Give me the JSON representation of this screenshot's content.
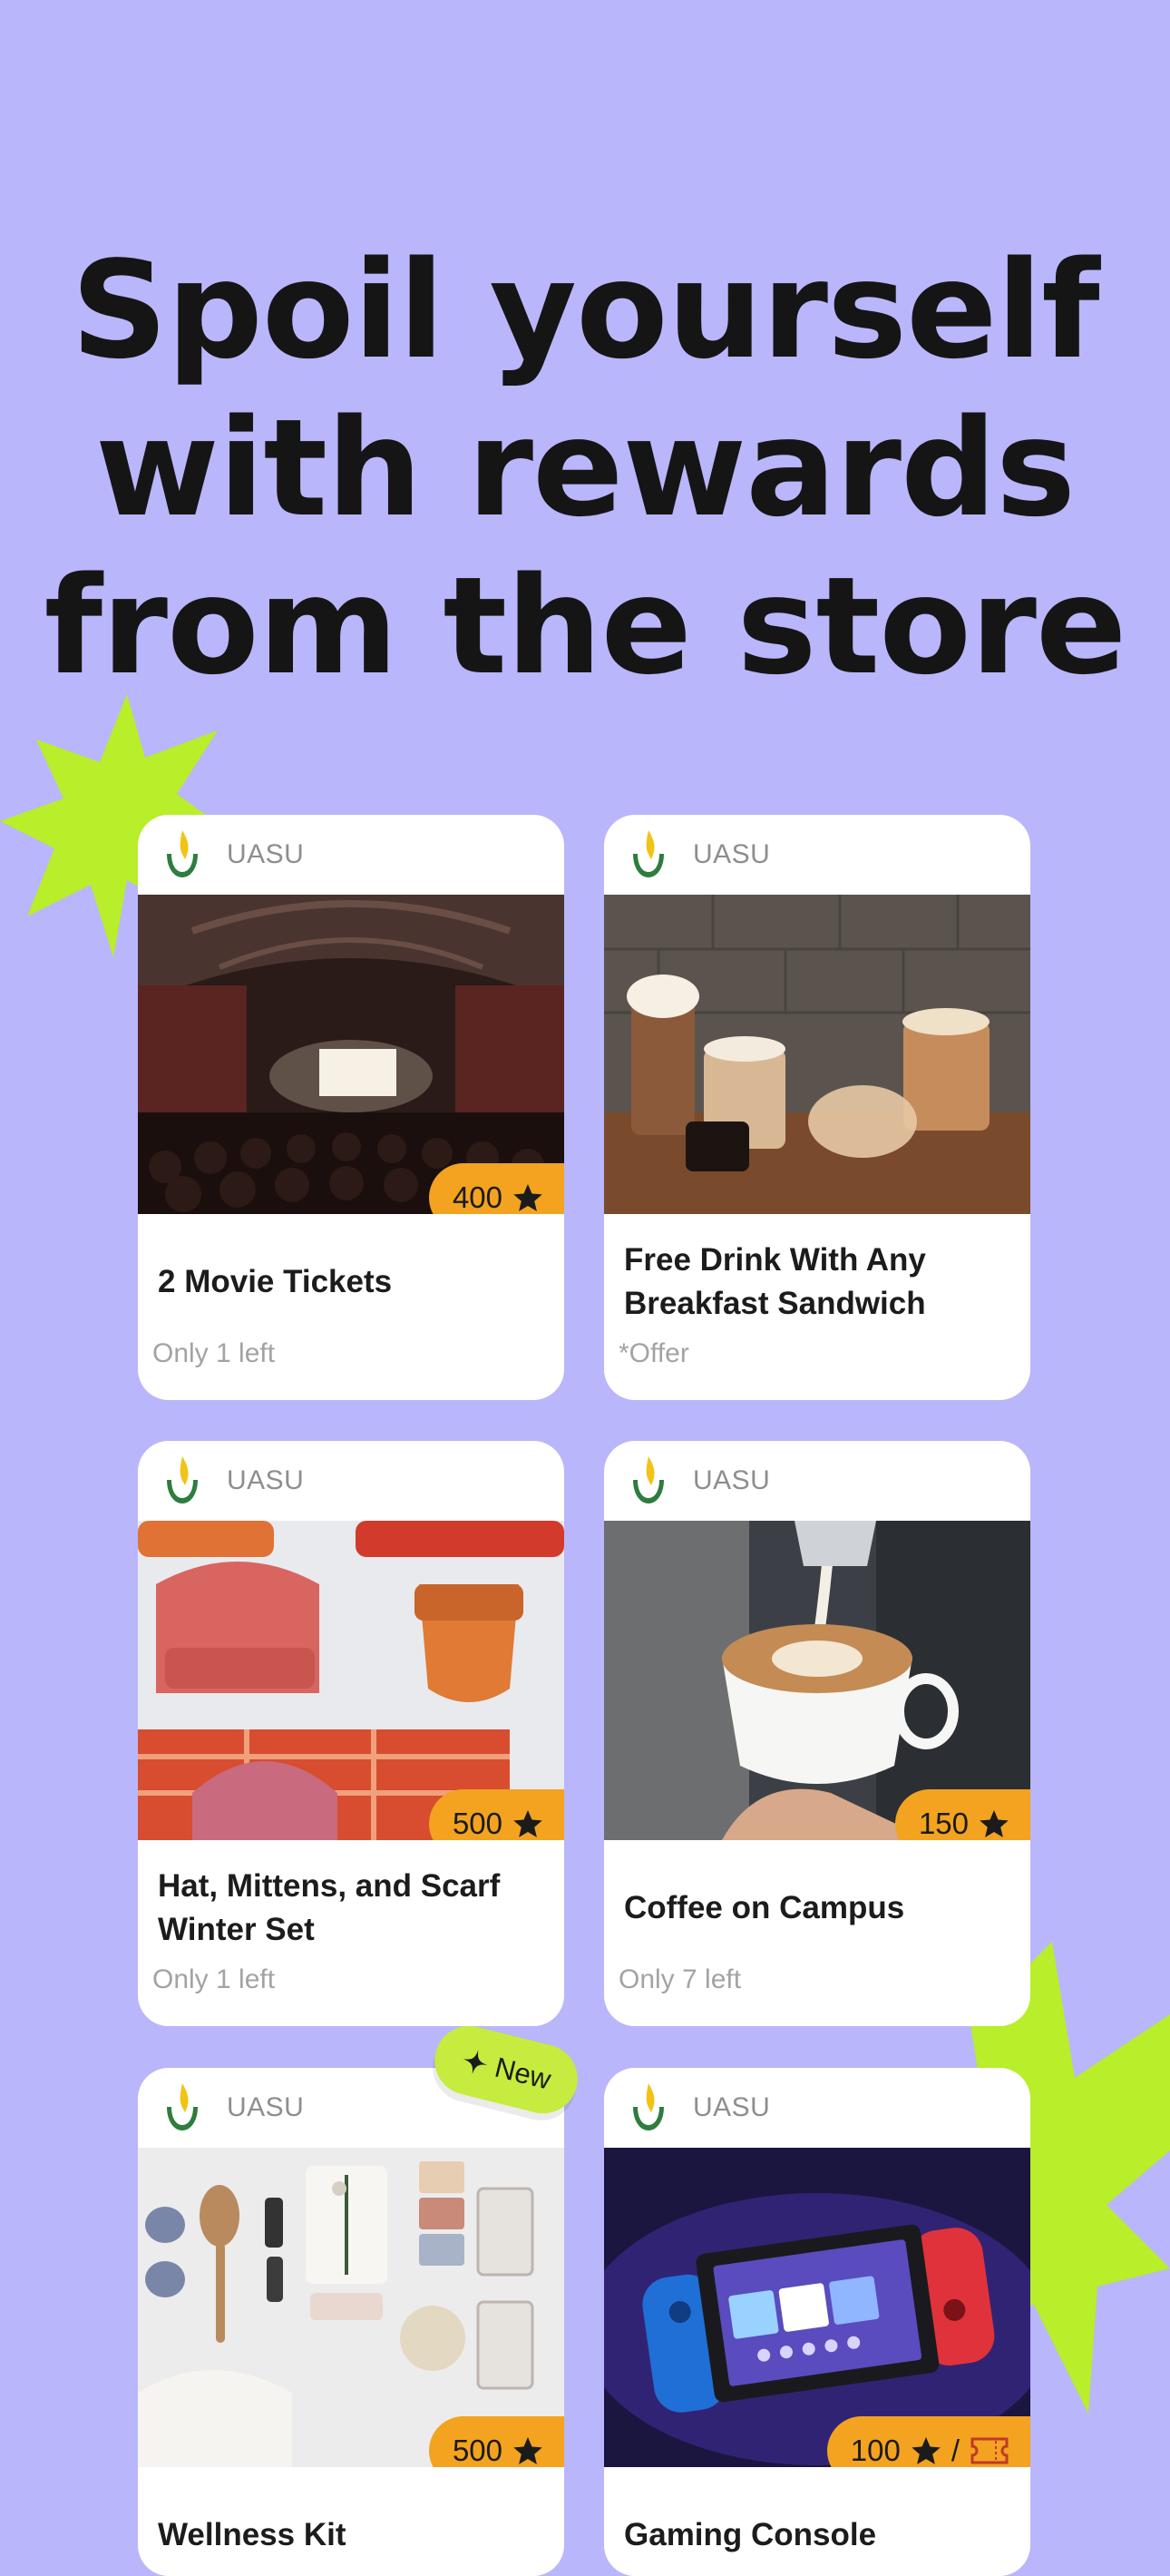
{
  "headline": {
    "line1": "Spoil yourself",
    "line2": "with rewards",
    "line3": "from the store"
  },
  "colors": {
    "background": "#b9b6fb",
    "accent_lime": "#b8ee2a",
    "badge_orange": "#f3a31f"
  },
  "cards": [
    {
      "brand": "UASU",
      "title": "2 Movie Tickets",
      "price": "400",
      "footer": "Only 1 left",
      "image": "movie-theater"
    },
    {
      "brand": "UASU",
      "title": "Free Drink With Any Breakfast Sandwich",
      "price": "",
      "footer": "*Offer",
      "image": "coffee-drinks"
    },
    {
      "brand": "UASU",
      "title": "Hat, Mittens, and Scarf Winter Set",
      "price": "500",
      "footer": "Only 1 left",
      "image": "winter-knits"
    },
    {
      "brand": "UASU",
      "title": "Coffee on Campus",
      "price": "150",
      "footer": "Only 7 left",
      "image": "latte-art"
    },
    {
      "brand": "UASU",
      "title": "Wellness Kit",
      "price": "500",
      "footer": "",
      "image": "wellness-items"
    },
    {
      "brand": "UASU",
      "title": "Gaming Console",
      "price": "100",
      "price_separator": "/",
      "footer": "",
      "image": "handheld-console"
    }
  ],
  "new_badge": {
    "label": "New",
    "icon": "sparkle-icon"
  },
  "icons": {
    "price": "star-icon",
    "alt_price": "ticket-icon",
    "brand_logo": "flame-logo-icon"
  }
}
